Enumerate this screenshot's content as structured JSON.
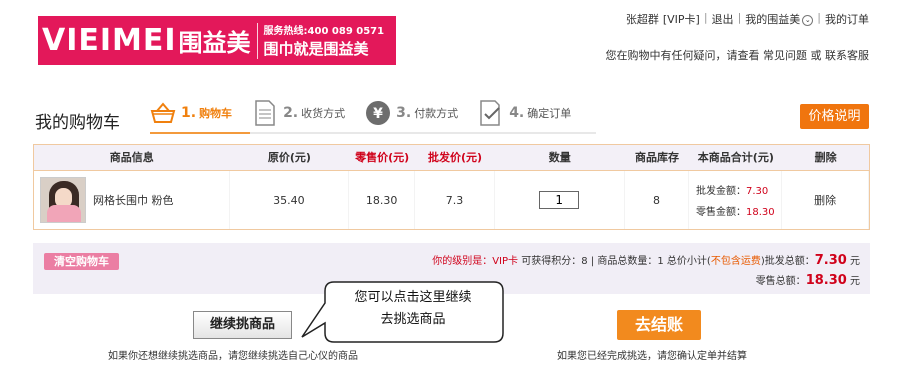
{
  "logo": {
    "brand_en": "VIEIMEI",
    "brand_cn": "围益美",
    "hotline": "服务热线:400 089 0571",
    "slogan": "围巾就是围益美"
  },
  "topnav": {
    "user": "张超群",
    "vip": "[VIP卡]",
    "logout": "退出",
    "my_account": "我的围益美",
    "orders": "我的订单",
    "sep": "|",
    "circle_icon": "chevron-down"
  },
  "help": {
    "text": "您在购物中有任何疑问，请查看",
    "faq": "常见问题",
    "or": "或",
    "contact": "联系客服"
  },
  "page": {
    "title": "我的购物车"
  },
  "steps": [
    {
      "num": "1.",
      "label": "购物车",
      "icon": "basket-icon",
      "active": true
    },
    {
      "num": "2.",
      "label": "收货方式",
      "icon": "document-icon",
      "active": false
    },
    {
      "num": "3.",
      "label": "付款方式",
      "icon": "yen-icon",
      "active": false
    },
    {
      "num": "4.",
      "label": "确定订单",
      "icon": "checklist-icon",
      "active": false
    }
  ],
  "price_button": "价格说明",
  "table": {
    "headers": [
      "商品信息",
      "原价(元)",
      "零售价(元)",
      "批发价(元)",
      "数量",
      "商品库存",
      "本商品合计(元)",
      "删除"
    ],
    "rows": [
      {
        "name": "网格长围巾 粉色",
        "original": "35.40",
        "retail": "18.30",
        "wholesale": "7.3",
        "qty": "1",
        "stock": "8",
        "wholesale_total_label": "批发金额：",
        "wholesale_total": "7.30",
        "retail_total_label": "零售金额：",
        "retail_total": "18.30",
        "delete": "删除"
      }
    ]
  },
  "summary": {
    "clear_button": "清空购物车",
    "level_label": "你的级别是：",
    "level": "VIP卡",
    "points_text": "可获得积分：8",
    "sep": "|",
    "count_text": "商品总数量：1",
    "subtotal_text": "总价小计(",
    "shipping_note": "不包含运费",
    "subtotal_close": ")",
    "wholesale_total_label": "批发总额：",
    "wholesale_total": "7.30",
    "retail_total_label": "零售总额：",
    "retail_total": "18.30",
    "unit": "元"
  },
  "actions": {
    "continue_button": "继续挑商品",
    "continue_hint": "如果你还想继续挑选商品，请您继续挑选自己心仪的商品",
    "checkout_button": "去结账",
    "checkout_hint": "如果您已经完成挑选，请您确认定单并结算"
  },
  "callout": {
    "line1": "您可以点击这里继续",
    "line2": "去挑选商品"
  },
  "colors": {
    "brand": "#e3185a",
    "accent": "#f0750e",
    "price_red": "#d0021b",
    "summary_bg": "#f1eef6"
  }
}
